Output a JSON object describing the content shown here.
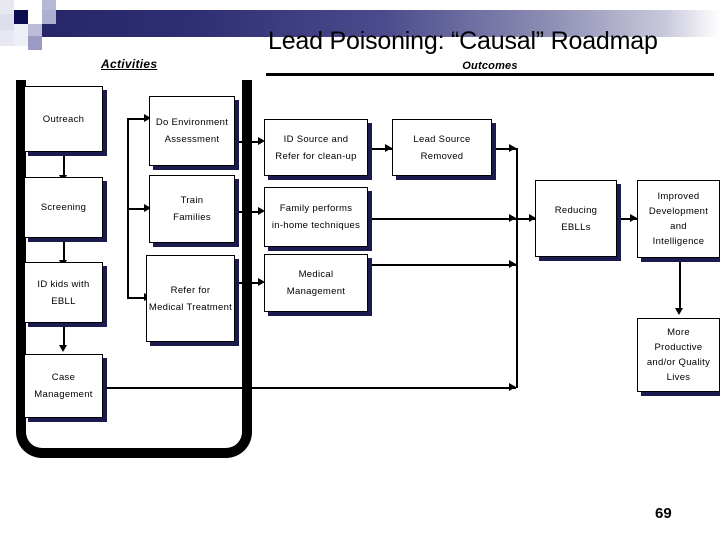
{
  "slide": {
    "title": "Lead Poisoning: “Causal” Roadmap",
    "page_number": "69",
    "column_headers": {
      "activities": "Activities",
      "outcomes": "Outcomes"
    },
    "accent_colors": {
      "band_dark": "#262669",
      "band_light": "#c9c9dc",
      "shadow": "#1b1b4f",
      "line": "#000000"
    }
  },
  "decor": {
    "squares": [
      {
        "name": "square-dark-navy",
        "color": "#0d0d52"
      },
      {
        "name": "square-light-lavender",
        "color": "#b7b7d6"
      },
      {
        "name": "square-mid-lavender",
        "color": "#9a9ac4"
      },
      {
        "name": "square-pale-lavender",
        "color": "#d7d7e7"
      }
    ]
  },
  "diagram": {
    "type": "flowchart",
    "boxes": [
      {
        "id": "outreach",
        "lines": [
          "Outreach"
        ]
      },
      {
        "id": "screening",
        "lines": [
          "Screening"
        ]
      },
      {
        "id": "id-kids-ebll",
        "lines": [
          "ID kids with",
          "EBLL"
        ]
      },
      {
        "id": "case-management",
        "lines": [
          "Case",
          "Management"
        ]
      },
      {
        "id": "do-env-assessment",
        "lines": [
          "Do Environment",
          "Assessment"
        ]
      },
      {
        "id": "train-families",
        "lines": [
          "Train",
          "Families"
        ]
      },
      {
        "id": "refer-med-treatment",
        "lines": [
          "Refer for",
          "Medical Treatment"
        ]
      },
      {
        "id": "id-source-cleanup",
        "lines": [
          "ID Source and",
          "Refer for clean-up"
        ]
      },
      {
        "id": "family-in-home",
        "lines": [
          "Family performs",
          "in-home techniques"
        ]
      },
      {
        "id": "medical-management",
        "lines": [
          "Medical",
          "Management"
        ]
      },
      {
        "id": "lead-source-removed",
        "lines": [
          "Lead Source",
          "Removed"
        ]
      },
      {
        "id": "reducing-ebll",
        "lines": [
          "Reducing",
          "EBLLs"
        ]
      },
      {
        "id": "improved-dev",
        "lines": [
          "Improved",
          "Development",
          "and",
          "Intelligence"
        ]
      },
      {
        "id": "more-productive",
        "lines": [
          "More",
          "Productive",
          "and/or Quality",
          "Lives"
        ]
      }
    ],
    "edges": [
      {
        "from": "outreach",
        "to": "screening"
      },
      {
        "from": "screening",
        "to": "id-kids-ebll"
      },
      {
        "from": "id-kids-ebll",
        "to": "case-management"
      },
      {
        "from": "outreach",
        "to": "do-env-assessment"
      },
      {
        "from": "screening",
        "to": "train-families"
      },
      {
        "from": "id-kids-ebll",
        "to": "refer-med-treatment"
      },
      {
        "from": "case-management",
        "to": "medical-management"
      },
      {
        "from": "do-env-assessment",
        "to": "id-source-cleanup"
      },
      {
        "from": "train-families",
        "to": "family-in-home"
      },
      {
        "from": "refer-med-treatment",
        "to": "medical-management"
      },
      {
        "from": "id-source-cleanup",
        "to": "lead-source-removed"
      },
      {
        "from": "lead-source-removed",
        "to": "reducing-ebll"
      },
      {
        "from": "family-in-home",
        "to": "reducing-ebll"
      },
      {
        "from": "medical-management",
        "to": "reducing-ebll"
      },
      {
        "from": "reducing-ebll",
        "to": "improved-dev"
      },
      {
        "from": "improved-dev",
        "to": "more-productive"
      }
    ]
  }
}
